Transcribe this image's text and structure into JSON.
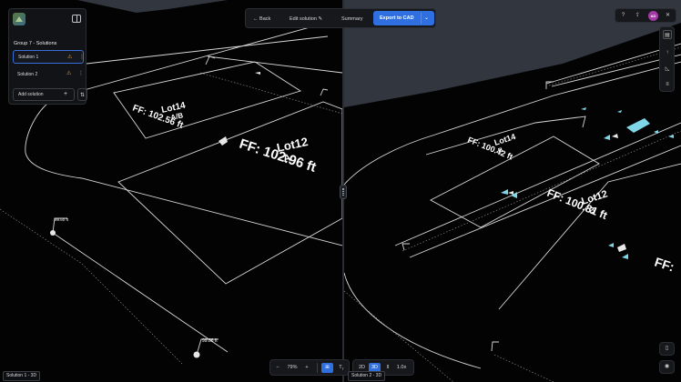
{
  "panel": {
    "group_title": "Group 7 - Solutions",
    "solutions": [
      {
        "label": "Solution 1",
        "active": true
      },
      {
        "label": "Solution 2",
        "active": false
      }
    ],
    "add_label": "Add solution"
  },
  "toolbar": {
    "back_label": "Back",
    "edit_label": "Edit solution",
    "summary_label": "Summary",
    "export_label": "Export to CAD"
  },
  "user": {
    "initials": "AD"
  },
  "bottom": {
    "zoom_value": "79%",
    "mode_2d": "2D",
    "mode_3d": "3D",
    "speed_value": "1.0x"
  },
  "viewports": {
    "left_label": "Solution 1 - 3D",
    "right_label": "Solution 2 - 3D"
  },
  "left_scene": {
    "lot_a": {
      "name": "Lot14",
      "sub": "A/B",
      "ff": "FF: 102.56 ft"
    },
    "lot_b": {
      "name": "Lot12",
      "sub": "A",
      "ff": "FF: 102.96 ft"
    },
    "spot1": "99.60 ft",
    "spot2": "99.86 ft"
  },
  "right_scene": {
    "lot_a": {
      "name": "Lot14",
      "sub": "B",
      "ff": "FF: 100.42 ft"
    },
    "lot_b": {
      "name": "Lot12",
      "sub": "B",
      "ff": "FF: 100.81 ft"
    },
    "edge_ff": "FF:"
  },
  "colors": {
    "accent": "#2f6fe0",
    "avatar": "#a33aa6",
    "warning": "#e0a040",
    "marker": "#7fd6e8"
  }
}
